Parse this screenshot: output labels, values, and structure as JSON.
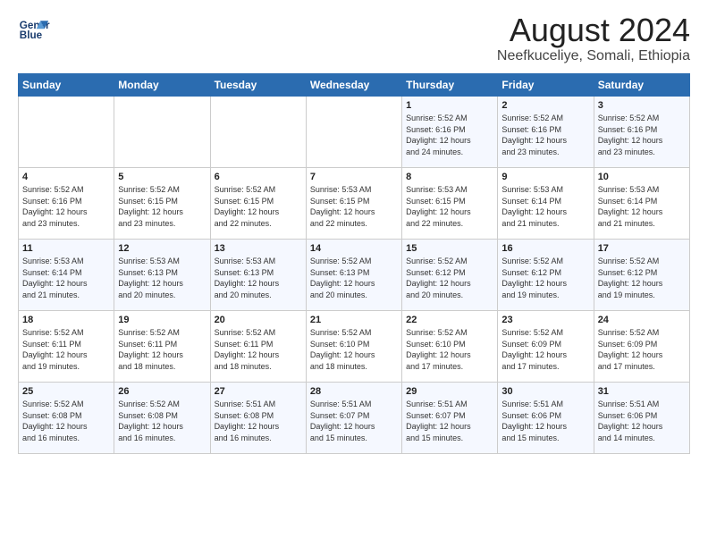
{
  "header": {
    "logo_line1": "General",
    "logo_line2": "Blue",
    "month_year": "August 2024",
    "location": "Neefkuceliye, Somali, Ethiopia"
  },
  "weekdays": [
    "Sunday",
    "Monday",
    "Tuesday",
    "Wednesday",
    "Thursday",
    "Friday",
    "Saturday"
  ],
  "weeks": [
    [
      {
        "day": "",
        "info": ""
      },
      {
        "day": "",
        "info": ""
      },
      {
        "day": "",
        "info": ""
      },
      {
        "day": "",
        "info": ""
      },
      {
        "day": "1",
        "info": "Sunrise: 5:52 AM\nSunset: 6:16 PM\nDaylight: 12 hours\nand 24 minutes."
      },
      {
        "day": "2",
        "info": "Sunrise: 5:52 AM\nSunset: 6:16 PM\nDaylight: 12 hours\nand 23 minutes."
      },
      {
        "day": "3",
        "info": "Sunrise: 5:52 AM\nSunset: 6:16 PM\nDaylight: 12 hours\nand 23 minutes."
      }
    ],
    [
      {
        "day": "4",
        "info": "Sunrise: 5:52 AM\nSunset: 6:16 PM\nDaylight: 12 hours\nand 23 minutes."
      },
      {
        "day": "5",
        "info": "Sunrise: 5:52 AM\nSunset: 6:15 PM\nDaylight: 12 hours\nand 23 minutes."
      },
      {
        "day": "6",
        "info": "Sunrise: 5:52 AM\nSunset: 6:15 PM\nDaylight: 12 hours\nand 22 minutes."
      },
      {
        "day": "7",
        "info": "Sunrise: 5:53 AM\nSunset: 6:15 PM\nDaylight: 12 hours\nand 22 minutes."
      },
      {
        "day": "8",
        "info": "Sunrise: 5:53 AM\nSunset: 6:15 PM\nDaylight: 12 hours\nand 22 minutes."
      },
      {
        "day": "9",
        "info": "Sunrise: 5:53 AM\nSunset: 6:14 PM\nDaylight: 12 hours\nand 21 minutes."
      },
      {
        "day": "10",
        "info": "Sunrise: 5:53 AM\nSunset: 6:14 PM\nDaylight: 12 hours\nand 21 minutes."
      }
    ],
    [
      {
        "day": "11",
        "info": "Sunrise: 5:53 AM\nSunset: 6:14 PM\nDaylight: 12 hours\nand 21 minutes."
      },
      {
        "day": "12",
        "info": "Sunrise: 5:53 AM\nSunset: 6:13 PM\nDaylight: 12 hours\nand 20 minutes."
      },
      {
        "day": "13",
        "info": "Sunrise: 5:53 AM\nSunset: 6:13 PM\nDaylight: 12 hours\nand 20 minutes."
      },
      {
        "day": "14",
        "info": "Sunrise: 5:52 AM\nSunset: 6:13 PM\nDaylight: 12 hours\nand 20 minutes."
      },
      {
        "day": "15",
        "info": "Sunrise: 5:52 AM\nSunset: 6:12 PM\nDaylight: 12 hours\nand 20 minutes."
      },
      {
        "day": "16",
        "info": "Sunrise: 5:52 AM\nSunset: 6:12 PM\nDaylight: 12 hours\nand 19 minutes."
      },
      {
        "day": "17",
        "info": "Sunrise: 5:52 AM\nSunset: 6:12 PM\nDaylight: 12 hours\nand 19 minutes."
      }
    ],
    [
      {
        "day": "18",
        "info": "Sunrise: 5:52 AM\nSunset: 6:11 PM\nDaylight: 12 hours\nand 19 minutes."
      },
      {
        "day": "19",
        "info": "Sunrise: 5:52 AM\nSunset: 6:11 PM\nDaylight: 12 hours\nand 18 minutes."
      },
      {
        "day": "20",
        "info": "Sunrise: 5:52 AM\nSunset: 6:11 PM\nDaylight: 12 hours\nand 18 minutes."
      },
      {
        "day": "21",
        "info": "Sunrise: 5:52 AM\nSunset: 6:10 PM\nDaylight: 12 hours\nand 18 minutes."
      },
      {
        "day": "22",
        "info": "Sunrise: 5:52 AM\nSunset: 6:10 PM\nDaylight: 12 hours\nand 17 minutes."
      },
      {
        "day": "23",
        "info": "Sunrise: 5:52 AM\nSunset: 6:09 PM\nDaylight: 12 hours\nand 17 minutes."
      },
      {
        "day": "24",
        "info": "Sunrise: 5:52 AM\nSunset: 6:09 PM\nDaylight: 12 hours\nand 17 minutes."
      }
    ],
    [
      {
        "day": "25",
        "info": "Sunrise: 5:52 AM\nSunset: 6:08 PM\nDaylight: 12 hours\nand 16 minutes."
      },
      {
        "day": "26",
        "info": "Sunrise: 5:52 AM\nSunset: 6:08 PM\nDaylight: 12 hours\nand 16 minutes."
      },
      {
        "day": "27",
        "info": "Sunrise: 5:51 AM\nSunset: 6:08 PM\nDaylight: 12 hours\nand 16 minutes."
      },
      {
        "day": "28",
        "info": "Sunrise: 5:51 AM\nSunset: 6:07 PM\nDaylight: 12 hours\nand 15 minutes."
      },
      {
        "day": "29",
        "info": "Sunrise: 5:51 AM\nSunset: 6:07 PM\nDaylight: 12 hours\nand 15 minutes."
      },
      {
        "day": "30",
        "info": "Sunrise: 5:51 AM\nSunset: 6:06 PM\nDaylight: 12 hours\nand 15 minutes."
      },
      {
        "day": "31",
        "info": "Sunrise: 5:51 AM\nSunset: 6:06 PM\nDaylight: 12 hours\nand 14 minutes."
      }
    ]
  ]
}
